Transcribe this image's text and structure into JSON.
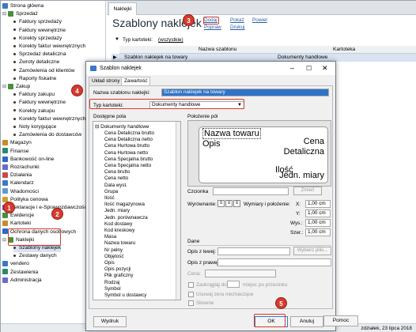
{
  "sidebar": {
    "items": [
      {
        "label": "Strona główna",
        "kind": "icon",
        "color": "#3d78c4"
      },
      {
        "label": "Sprzedaż",
        "kind": "group",
        "color": "#4a8f3c"
      },
      {
        "label": "Faktury sprzedaży",
        "kind": "sub"
      },
      {
        "label": "Faktury wewnętrzne",
        "kind": "sub"
      },
      {
        "label": "Korekty sprzedaży",
        "kind": "sub"
      },
      {
        "label": "Korekty faktur wewnętrznych",
        "kind": "sub"
      },
      {
        "label": "Sprzedaż detaliczna",
        "kind": "sub"
      },
      {
        "label": "Zwroty detaliczne",
        "kind": "sub"
      },
      {
        "label": "Zamówienia od klientów",
        "kind": "sub"
      },
      {
        "label": "Raporty fiskalne",
        "kind": "sub"
      },
      {
        "label": "Zakup",
        "kind": "group",
        "color": "#4a8f3c"
      },
      {
        "label": "Faktury zakupu",
        "kind": "sub"
      },
      {
        "label": "Faktury wewnętrzne",
        "kind": "sub"
      },
      {
        "label": "Korekty zakupu",
        "kind": "sub"
      },
      {
        "label": "Korekty faktur wewnętrznych",
        "kind": "sub"
      },
      {
        "label": "Noty korygujące",
        "kind": "sub"
      },
      {
        "label": "Zamówienia do dostawców",
        "kind": "sub"
      },
      {
        "label": "Magazyn",
        "kind": "icon",
        "color": "#c98a2a"
      },
      {
        "label": "Finanse",
        "kind": "icon",
        "color": "#2a8a6a"
      },
      {
        "label": "Bankowość on-line",
        "kind": "icon",
        "color": "#2a6ac9"
      },
      {
        "label": "Rozrachunki",
        "kind": "icon",
        "color": "#6a6ac9"
      },
      {
        "label": "Działania",
        "kind": "icon",
        "color": "#c94a4a"
      },
      {
        "label": "Kalendarz",
        "kind": "icon",
        "color": "#3d78c4"
      },
      {
        "label": "Wiadomości",
        "kind": "icon",
        "color": "#5a9ad9"
      },
      {
        "label": "Polityka cenowa",
        "kind": "icon",
        "color": "#c9a02a"
      },
      {
        "label": "Deklaracje i e-Sprawozdawczość",
        "kind": "icon",
        "color": "#7a4ac9"
      },
      {
        "label": "Ewidencje",
        "kind": "icon",
        "color": "#4a8f3c"
      },
      {
        "label": "Kartoteki",
        "kind": "icon",
        "color": "#c98a2a"
      },
      {
        "label": "Ochrona danych osobowych",
        "kind": "icon",
        "color": "#2a6ac9"
      },
      {
        "label": "Naklejki",
        "kind": "group",
        "color": "#4a8f3c"
      },
      {
        "label": "Szablony naklejek",
        "kind": "sub"
      },
      {
        "label": "Zestawy danych",
        "kind": "sub"
      },
      {
        "label": "vendero",
        "kind": "icon",
        "color": "#3d78c4"
      },
      {
        "label": "Zestawienia",
        "kind": "icon",
        "color": "#2a8a6a"
      },
      {
        "label": "Administracja",
        "kind": "icon",
        "color": "#6a6ac9"
      }
    ]
  },
  "main": {
    "tab": "Naklejki",
    "title": "Szablony naklejek",
    "actions": {
      "add": "Dodaj",
      "show": "Pokaż",
      "dup": "Powiel",
      "fix": "Popraw",
      "print": "Drukuj"
    },
    "filter_label": "Typ kartoteki:",
    "filter_value": "(wszystkie)",
    "col_name": "Nazwa szablonu",
    "col_kartoteka": "Kartoteka",
    "row_name": "Szablon naklejek na towary",
    "row_kartoteka": "Dokumenty handlowe",
    "status_date": "zdziałek, 23 lipca 2018"
  },
  "dialog": {
    "title": "Szablon naklejek",
    "tabs": [
      "Układ strony",
      "Zawartość"
    ],
    "name_label": "Nazwa szablonu naklejki:",
    "name_value": "Szablon naklejek na towary",
    "type_label": "Typ kartoteki:",
    "type_value": "Dokumenty handlowe",
    "fields_label": "Dostępne pola",
    "fields_root": "Dokumenty handlowe",
    "fields": [
      "Cena Detaliczna brutto",
      "Cena Detaliczna netto",
      "Cena Hurtowa brutto",
      "Cena Hurtowa netto",
      "Cena Specjalna brutto",
      "Cena Specjalna netto",
      "Cena brutto",
      "Cena netto",
      "Data wyst.",
      "Grupa",
      "Ilość",
      "Ilość magazynowa",
      "Jedn. miary",
      "Jedn. porównawcza",
      "Kod dostawy",
      "Kod kreskowy",
      "Masa",
      "Nazwa towaru",
      "Nr pełny",
      "Objętość",
      "Opis",
      "Opis pozycji",
      "Plik graficzny",
      "Rodzaj",
      "Symbol",
      "Symbol u dostawcy"
    ],
    "position_label": "Położenie pól",
    "preview": {
      "name": "Nazwa towaru",
      "opis": "Opis",
      "cena": "Cena",
      "cena_type": "Detaliczna",
      "ilosc": "Ilość",
      "jm": "Jedn. miary"
    },
    "font_label": "Czcionka",
    "font_btn": "Zmień",
    "align_label": "Wyrównanie:",
    "size_label": "Wymiary i położenie:",
    "x_label": "X:",
    "y_label": "Y:",
    "wys_label": "Wys.:",
    "szer_label": "Szer.:",
    "x_val": "1,00 cm",
    "y_val": "1,00 cm",
    "wys_val": "1,00 cm",
    "szer_val": "1,00 cm",
    "dane_label": "Dane",
    "opis_lewej": "Opis z lewej:",
    "opis_prawej": "Opis z prawej:",
    "cena_label": "Cena:",
    "pick_btn": "Wybierz pliki...",
    "cb1": "Zaokrąglaj do",
    "cb1b": "miejsc po przecinku",
    "cb2": "Usuwaj zera nieznaczące",
    "cb3": "Słownie",
    "btn_preview": "Wydruk",
    "btn_ok": "OK",
    "btn_cancel": "Anuluj",
    "btn_help": "Pomoc"
  },
  "callouts": [
    "1",
    "2",
    "3",
    "4",
    "5"
  ]
}
